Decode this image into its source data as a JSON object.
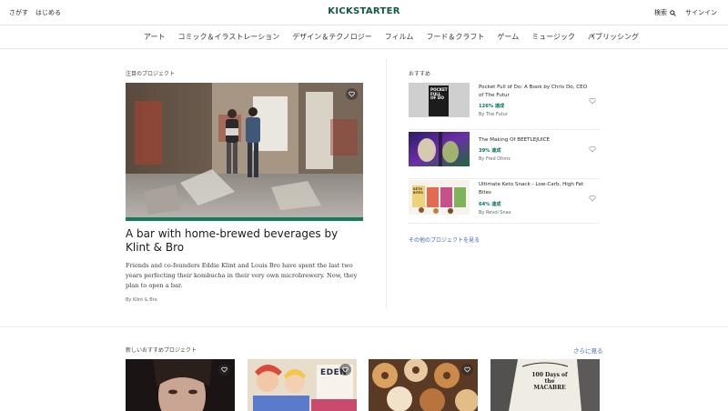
{
  "header": {
    "left_links": [
      "さがす",
      "はじめる"
    ],
    "logo_text": "KICKSTARTER",
    "search_label": "検索",
    "signin_label": "サインイン"
  },
  "categories": [
    "アート",
    "コミック＆イラストレーション",
    "デザイン＆テクノロジー",
    "フィルム",
    "フード＆クラフト",
    "ゲーム",
    "ミュージック",
    "パブリッシング"
  ],
  "featured": {
    "section_label": "注目のプロジェクト",
    "title": "A bar with home-brewed beverages by Klint & Bro",
    "description": "Friends and co-founders Eddie Klint and Louis Bro have spent the last two years perfecting their kombucha in their very own microbrewery. Now, they plan to open a bar.",
    "by": "By Klint & Bro"
  },
  "recommended": {
    "section_label": "おすすめ",
    "items": [
      {
        "title": "Pocket Full of Do: A Book by Chris Do, CEO of The Futur",
        "funded": "126% 達成",
        "by": "By The Futur",
        "thumb_text": "POCKET FULL OF DO"
      },
      {
        "title": "The Making Of BEETLEJUICE",
        "funded": "39% 達成",
        "by": "By Fred Ohms"
      },
      {
        "title": "Ultimate Keto Snack - Low-Carb, High Fat Bites",
        "funded": "64% 達成",
        "by": "By Revol Snax",
        "thumb_text": "KETO BITES"
      }
    ],
    "more_link": "その他のプロジェクトを見る"
  },
  "new_projects": {
    "section_label": "新しいおすすめプロジェクト",
    "see_more": "さらに見る",
    "cards": [
      {
        "name": "portrait"
      },
      {
        "name": "comic",
        "text": "EDEN"
      },
      {
        "name": "donuts"
      },
      {
        "name": "book",
        "text": "100 Days of the MACABRE"
      }
    ]
  },
  "colors": {
    "brand_green": "#05ce78",
    "funded_green": "#037362",
    "link_blue": "#3b65c7",
    "featured_bar": "#167a5c"
  }
}
